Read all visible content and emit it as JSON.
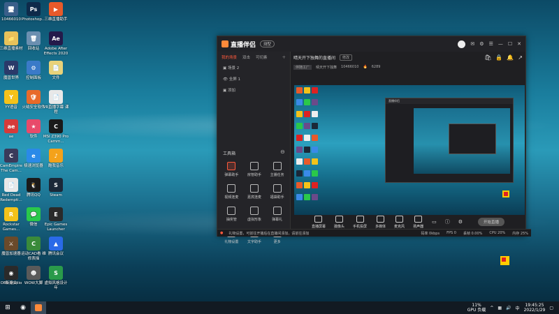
{
  "desktop": {
    "icons": [
      {
        "label": "10466010",
        "color": "#3a5f8a",
        "glyph": "🖥"
      },
      {
        "label": "Photoshop...",
        "color": "#0e2a4a",
        "glyph": "Ps"
      },
      {
        "label": "三维直播助手",
        "color": "#e85a2a",
        "glyph": "▶"
      },
      {
        "label": "三维直播素材",
        "color": "#e8c25a",
        "glyph": "📁"
      },
      {
        "label": "回收站",
        "color": "#6b8fb0",
        "glyph": "🗑"
      },
      {
        "label": "Adobe After Effects 2020",
        "color": "#241a4a",
        "glyph": "Ae"
      },
      {
        "label": "魔兽世界",
        "color": "#2a3a6a",
        "glyph": "W"
      },
      {
        "label": "控制面板",
        "color": "#3a7ac8",
        "glyph": "⚙"
      },
      {
        "label": "文件",
        "color": "#e8d27a",
        "glyph": "📄"
      },
      {
        "label": "YY语音",
        "color": "#f4c21a",
        "glyph": "Y"
      },
      {
        "label": "火绒安全软件",
        "color": "#e86a2a",
        "glyph": "🛡"
      },
      {
        "label": "VR直播字幕 课程",
        "color": "#e8e8e8",
        "glyph": "📄"
      },
      {
        "label": "ae",
        "color": "#d63a3a",
        "glyph": "ae"
      },
      {
        "label": "软件",
        "color": "#e84a6a",
        "glyph": "★"
      },
      {
        "label": "MSI Z390 Pro Camm...",
        "color": "#1a1a1a",
        "glyph": "C"
      },
      {
        "label": "CamEmpire The Cam...",
        "color": "#3a3a5a",
        "glyph": "C"
      },
      {
        "label": "极速浏览器",
        "color": "#2a8ae8",
        "glyph": "e"
      },
      {
        "label": "酷我音乐",
        "color": "#f4a21a",
        "glyph": "♪"
      },
      {
        "label": "Red Dead Redempti...",
        "color": "#e8e8e8",
        "glyph": "📄"
      },
      {
        "label": "腾讯QQ",
        "color": "#1a1a1a",
        "glyph": "🐧"
      },
      {
        "label": "Steam",
        "color": "#1b2838",
        "glyph": "S"
      },
      {
        "label": "Rockstar Games...",
        "color": "#f4c21a",
        "glyph": "R"
      },
      {
        "label": "微信",
        "color": "#2ac84a",
        "glyph": "💬"
      },
      {
        "label": "Epic Games Launcher",
        "color": "#2a2a2a",
        "glyph": "E"
      },
      {
        "label": "魔兽加速器",
        "color": "#6a4a2a",
        "glyph": "⚔"
      },
      {
        "label": "运动CAD看 维修表描",
        "color": "#3a8a3a",
        "glyph": "C"
      },
      {
        "label": "腾讯会议",
        "color": "#2a6ae8",
        "glyph": "▲"
      },
      {
        "label": "新建文",
        "color": "#d22",
        "glyph": "◆"
      },
      {
        "label": "OBS Studio",
        "color": "#2a2a2a",
        "glyph": "◉"
      },
      {
        "label": "WOW大脚",
        "color": "#5a5a5a",
        "glyph": "☻"
      },
      {
        "label": "虚拟风格设计 年",
        "color": "#2a9a4a",
        "glyph": "S"
      }
    ]
  },
  "app": {
    "title": "直播伴侣",
    "badge": "测型",
    "left_tabs": [
      "我的场景",
      "双击",
      "可切素"
    ],
    "scenes": [
      "场景 2",
      "全屏 1",
      "添加"
    ],
    "tools_title": "工具箱",
    "tools": [
      "弹幕助手",
      "房管助手",
      "主播任务",
      "视频连麦",
      "嘉宾连麦",
      "福袋助手",
      "抽奖管",
      "虚拟形象",
      "弹幕礼",
      "礼物设置",
      "文字助手",
      "更多"
    ],
    "stream_title": "晴天开下独舞的直播间",
    "edit_tag": "修改",
    "sub_tag": "伴随工厂",
    "sub_text": "晴天开下独舞",
    "room_id": "10466010",
    "fans": "6289",
    "controls": [
      "直播屏幕",
      "摄像头",
      "手机投屏",
      "多媒体",
      "麦克风",
      "扬声器"
    ],
    "start_label": "开始直播",
    "status_warn": "礼物设置，可前往开播后在直播间添加，请前往添加",
    "status_stats": [
      "码率 0kbps",
      "FPS 0",
      "丢帧 0.00%",
      "CPU 20%",
      "内存 25%"
    ]
  },
  "taskbar": {
    "gpu": "11%",
    "gpu_label": "GPU 负载",
    "time": "19:45:25",
    "date": "2022/1/29",
    "ime": "中"
  },
  "colors": {
    "accent": "#ff5a3c"
  }
}
